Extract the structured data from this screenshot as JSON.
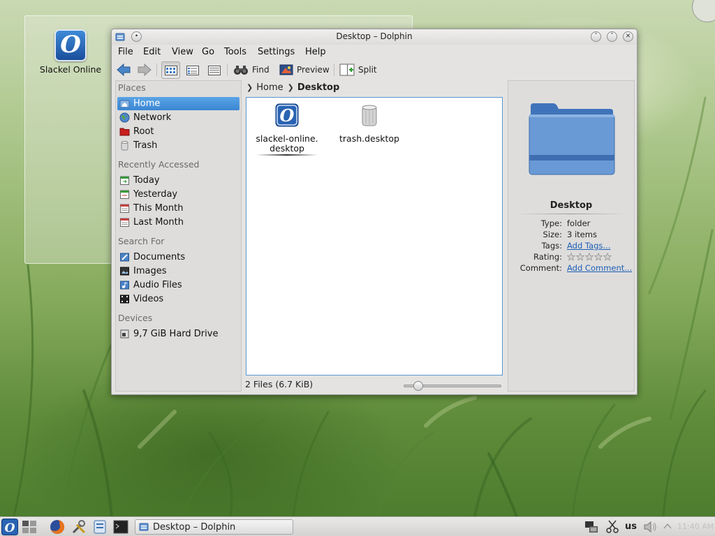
{
  "desktop": {
    "icon_label": "Slackel Online"
  },
  "window": {
    "title": "Desktop – Dolphin"
  },
  "menu": [
    "File",
    "Edit",
    "View",
    "Go",
    "Tools",
    "Settings",
    "Help"
  ],
  "toolbar": {
    "find_label": "Find",
    "preview_label": "Preview",
    "split_label": "Split"
  },
  "places": {
    "sections": {
      "places": "Places",
      "recent": "Recently Accessed",
      "search": "Search For",
      "devices": "Devices"
    },
    "items": {
      "home": "Home",
      "network": "Network",
      "root": "Root",
      "trash": "Trash",
      "today": "Today",
      "yesterday": "Yesterday",
      "this_month": "This Month",
      "last_month": "Last Month",
      "documents": "Documents",
      "images": "Images",
      "audio": "Audio Files",
      "videos": "Videos",
      "hard_drive": "9,7 GiB Hard Drive"
    }
  },
  "breadcrumb": {
    "home": "Home",
    "current": "Desktop"
  },
  "files": {
    "slackel_line1": "slackel-online.",
    "slackel_line2": "desktop",
    "trash": "trash.desktop"
  },
  "status": {
    "text": "2 Files (6.7 KiB)",
    "zoom_fraction": 0.1
  },
  "info": {
    "name": "Desktop",
    "type_key": "Type:",
    "type_val": "folder",
    "size_key": "Size:",
    "size_val": "3 items",
    "tags_key": "Tags:",
    "tags_val": "Add Tags...",
    "rating_key": "Rating:",
    "rating_val": 0,
    "comment_key": "Comment:",
    "comment_val": "Add Comment..."
  },
  "taskbar": {
    "task_label": "Desktop – Dolphin",
    "keyboard": "us",
    "clock": "11:40 AM"
  },
  "colors": {
    "selection": "#3b86d2",
    "link": "#1d5fb4",
    "folder": "#5b8fd0"
  }
}
